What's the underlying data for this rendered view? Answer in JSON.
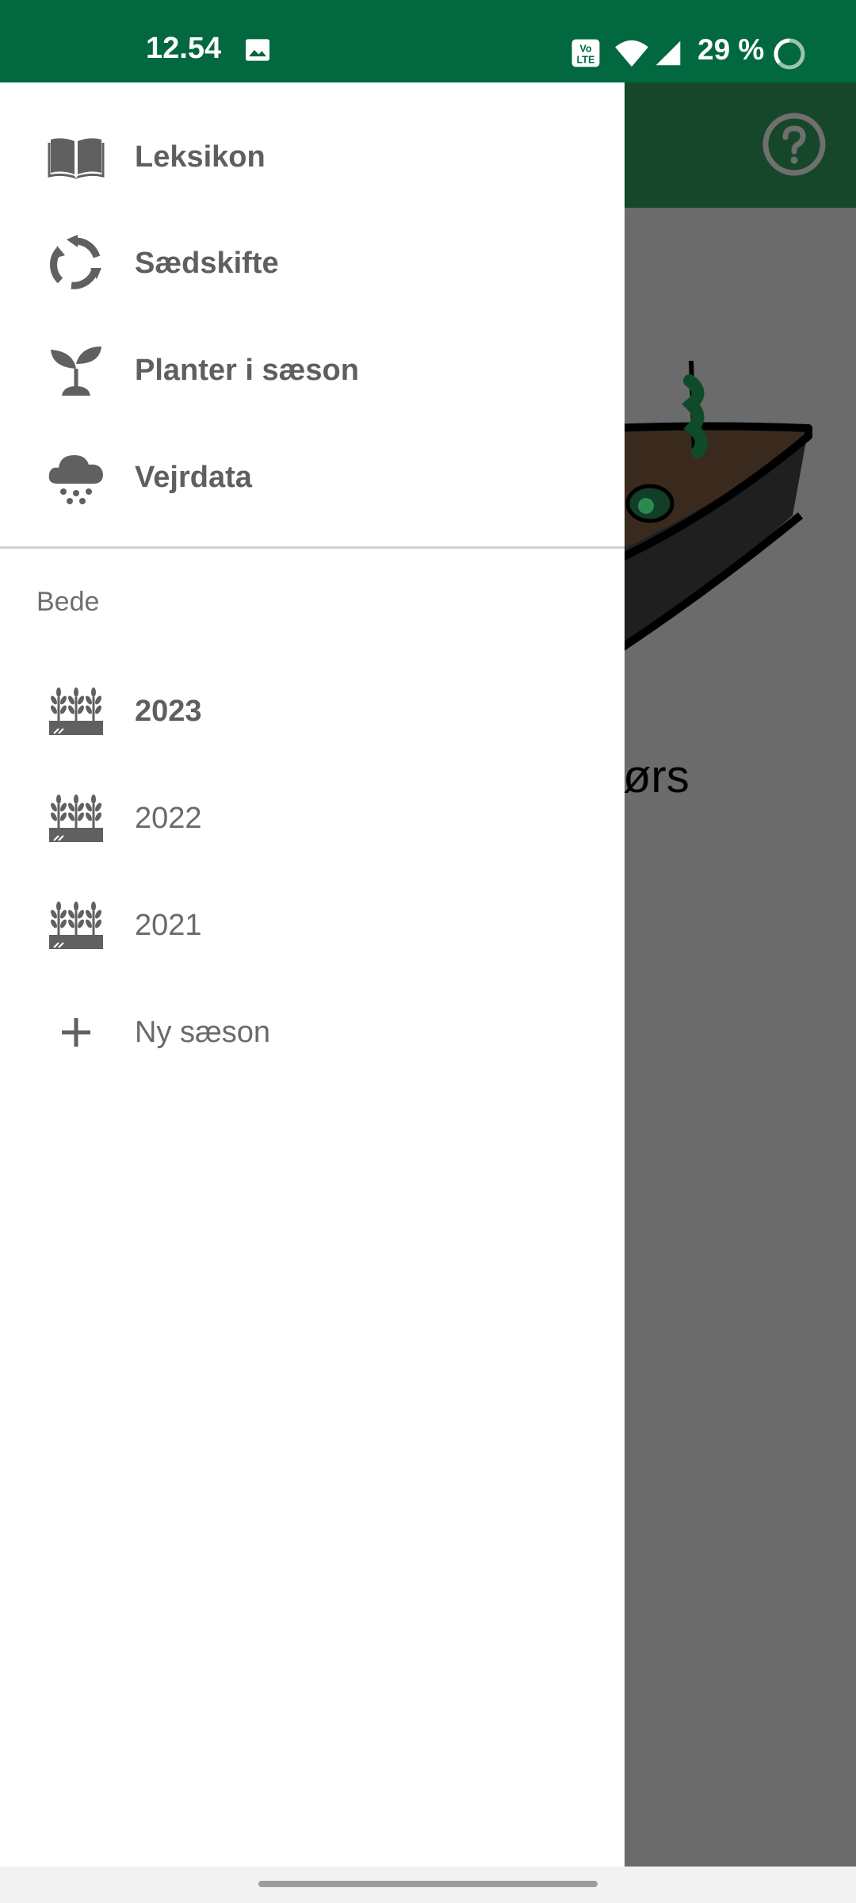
{
  "status_bar": {
    "time": "12.54",
    "battery": "29 %"
  },
  "background_screen": {
    "title_fragment": "ørs"
  },
  "drawer": {
    "menu": [
      {
        "label": "Leksikon",
        "icon": "book-icon"
      },
      {
        "label": "Sædskifte",
        "icon": "rotation-icon"
      },
      {
        "label": "Planter i sæson",
        "icon": "sprout-icon"
      },
      {
        "label": "Vejrdata",
        "icon": "rain-cloud-icon"
      }
    ],
    "section_header": "Bede",
    "seasons": [
      {
        "label": "2023",
        "active": true
      },
      {
        "label": "2022",
        "active": false
      },
      {
        "label": "2021",
        "active": false
      }
    ],
    "add_season": "Ny sæson"
  },
  "colors": {
    "status_bar": "#01683f",
    "toolbar": "#17472a",
    "scrim": "#6b6b6b",
    "icon_gray": "#606060"
  }
}
